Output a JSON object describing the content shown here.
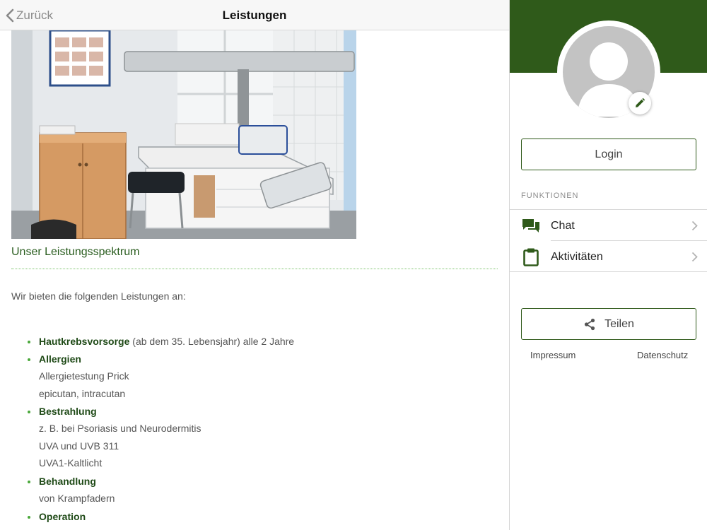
{
  "navbar": {
    "back_label": "Zurück",
    "title": "Leistungen"
  },
  "content": {
    "section_title": "Unser Leistungsspektrum",
    "intro": "Wir bieten die folgenden Leistungen an:",
    "services": [
      {
        "title": "Hautkrebsvorsorge",
        "suffix": " (ab dem 35. Lebensjahr) alle 2 Jahre",
        "details": []
      },
      {
        "title": "Allergien",
        "suffix": "",
        "details": [
          "Allergietestung Prick",
          "epicutan, intracutan"
        ]
      },
      {
        "title": "Bestrahlung",
        "suffix": "",
        "details": [
          "z. B. bei Psoriasis und Neurodermitis",
          "UVA und UVB 311",
          "UVA1-Kaltlicht"
        ]
      },
      {
        "title": "Behandlung",
        "suffix": "",
        "details": [
          "von Krampfadern"
        ]
      },
      {
        "title": "Operation",
        "suffix": "",
        "details": []
      }
    ]
  },
  "side": {
    "login_label": "Login",
    "section_label": "FUNKTIONEN",
    "menu": [
      {
        "label": "Chat",
        "icon": "chat-icon"
      },
      {
        "label": "Aktivitäten",
        "icon": "clipboard-icon"
      }
    ],
    "share_label": "Teilen",
    "impressum": "Impressum",
    "datenschutz": "Datenschutz"
  },
  "colors": {
    "brand_green": "#2f5a1a",
    "heading_green": "#2a5d1f",
    "bullet_green": "#4aa83a",
    "avatar_gray": "#c3c3c3"
  }
}
